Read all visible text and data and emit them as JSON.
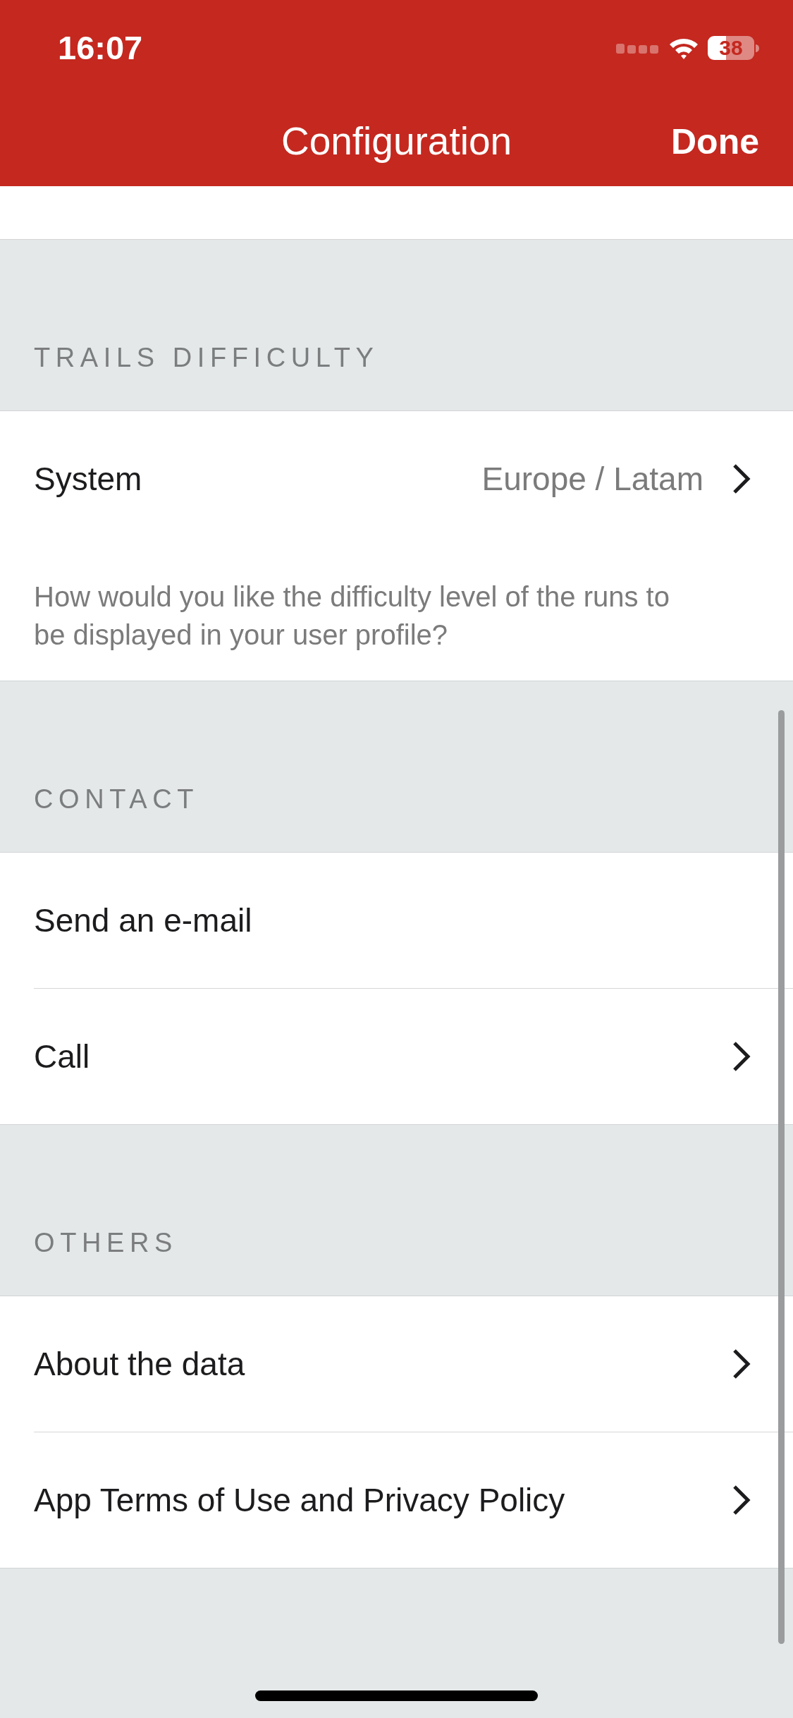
{
  "status_bar": {
    "time": "16:07",
    "battery": "38"
  },
  "nav_bar": {
    "title": "Configuration",
    "done": "Done"
  },
  "sections": [
    {
      "header": "TRAILS DIFFICULTY",
      "rows": [
        {
          "label": "System",
          "value": "Europe / Latam",
          "chevron": true
        }
      ],
      "footer": "How would you like the difficulty level of the runs to be displayed in your user profile?"
    },
    {
      "header": "CONTACT",
      "rows": [
        {
          "label": "Send an e-mail",
          "chevron": false
        },
        {
          "label": "Call",
          "chevron": true
        }
      ]
    },
    {
      "header": "OTHERS",
      "rows": [
        {
          "label": "About the data",
          "chevron": true
        },
        {
          "label": "App Terms of Use and Privacy Policy",
          "chevron": true
        }
      ]
    }
  ]
}
